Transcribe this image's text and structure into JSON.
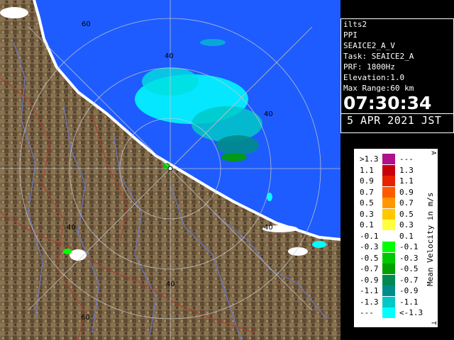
{
  "panel": {
    "site": "ilts2",
    "mode": "PPI",
    "product": "SEAICE2_A_V",
    "task": "Task: SEAICE2_A",
    "prf": "PRF: 1800Hz",
    "elevation": "Elevation:1.0",
    "max_range": "Max Range:60 km",
    "time": "07:30:34",
    "date": "5 APR 2021 JST"
  },
  "legend": {
    "unit": "Mean Velocity in m/s",
    "top_mark": "A",
    "bottom_mark": "T",
    "rows": [
      {
        "low": ">1.3",
        "high": "---",
        "color": "#b0108a"
      },
      {
        "low": "1.1",
        "high": "1.3",
        "color": "#c8000a"
      },
      {
        "low": "0.9",
        "high": "1.1",
        "color": "#e82000"
      },
      {
        "low": "0.7",
        "high": "0.9",
        "color": "#ff5a00"
      },
      {
        "low": "0.5",
        "high": "0.7",
        "color": "#ff9800"
      },
      {
        "low": "0.3",
        "high": "0.5",
        "color": "#ffc800"
      },
      {
        "low": "0.1",
        "high": "0.3",
        "color": "#ffff40"
      },
      {
        "low": "-0.1",
        "high": "0.1",
        "color": "#ffffff"
      },
      {
        "low": "-0.3",
        "high": "-0.1",
        "color": "#00ff00"
      },
      {
        "low": "-0.5",
        "high": "-0.3",
        "color": "#00c800"
      },
      {
        "low": "-0.7",
        "high": "-0.5",
        "color": "#00a000"
      },
      {
        "low": "-0.9",
        "high": "-0.7",
        "color": "#008a50"
      },
      {
        "low": "-1.1",
        "high": "-0.9",
        "color": "#008c8c"
      },
      {
        "low": "-1.3",
        "high": "-1.1",
        "color": "#00c8c8"
      },
      {
        "low": "---",
        "high": "<-1.3",
        "color": "#00ffff"
      }
    ]
  },
  "map": {
    "range_labels": [
      "60",
      "40",
      "40",
      "40",
      "40",
      "40",
      "60"
    ],
    "sea_color": "#1e5cff",
    "land_color": "#7a6446"
  }
}
